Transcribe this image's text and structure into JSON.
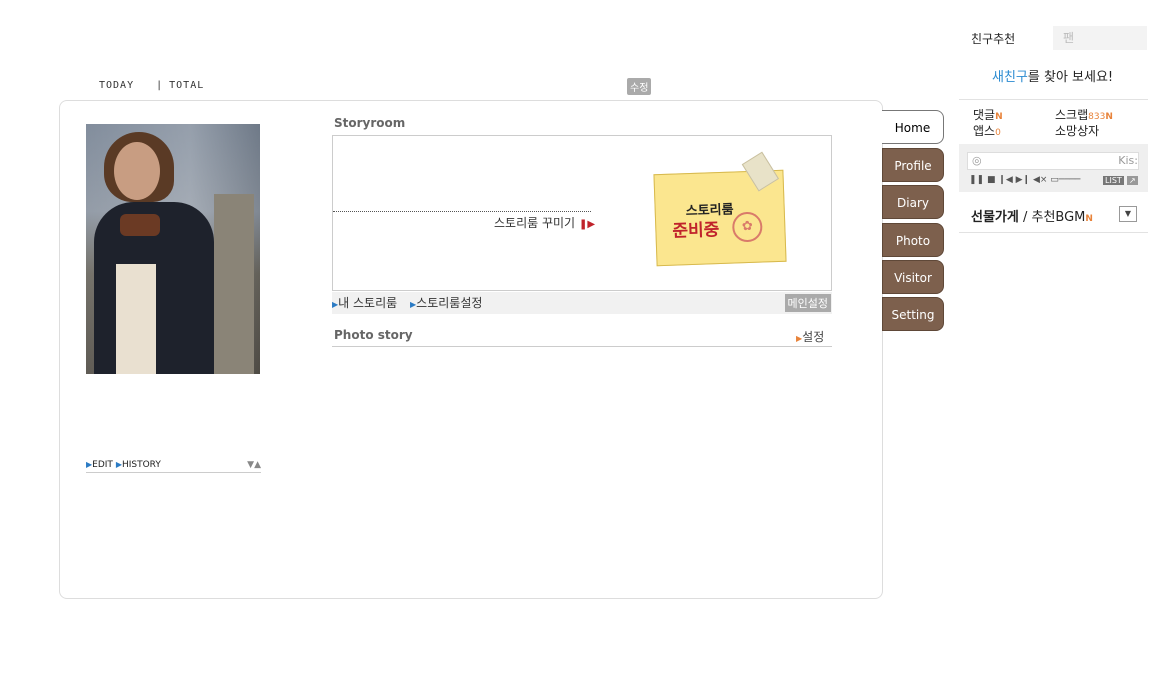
{
  "counter": {
    "today_label": "TODAY",
    "total_label": "TOTAL"
  },
  "header": {
    "edit_badge": "수정"
  },
  "profile": {
    "edit_label": "EDIT",
    "history_label": "HISTORY",
    "arrows": "▼▲"
  },
  "storyroom": {
    "title": "Storyroom",
    "decorate_link": "스토리룸 꾸미기",
    "note_line1": "스토리룸",
    "note_line2": "준비중",
    "my_storyroom": "내 스토리룸",
    "storyroom_settings": "스토리룸설정",
    "main_settings": "메인설정"
  },
  "photo_story": {
    "title": "Photo story",
    "setting_label": "설정"
  },
  "tabs": [
    {
      "label": "Home",
      "active": true
    },
    {
      "label": "Profile"
    },
    {
      "label": "Diary"
    },
    {
      "label": "Photo"
    },
    {
      "label": "Visitor"
    },
    {
      "label": "Setting"
    }
  ],
  "right_panel": {
    "friend_rec": "친구추천",
    "fan": "팬",
    "find_prefix": "새친구",
    "find_suffix": "를 찾아 보세요!",
    "comments_label": "댓글",
    "new_badge": "N",
    "scrap_label": "스크랩",
    "scrap_count": "833",
    "apps_label": "앱스",
    "apps_count": "0",
    "wishbox_label": "소망상자",
    "player_text": "Kis:",
    "player_controls": "❚❚ ■ ❙◀ ▶❙  ◀× ▭────",
    "list_label": "LIST",
    "popup_label": "↗",
    "gift_shop": "선물가게",
    "gift_sep": " / ",
    "bgm_rec": "추천BGM",
    "dropdown_icon": "▼"
  },
  "colors": {
    "tab_brown": "#7d604d",
    "link_blue": "#2b8bd1",
    "accent_orange": "#e8833a",
    "alert_red": "#c0232b"
  }
}
